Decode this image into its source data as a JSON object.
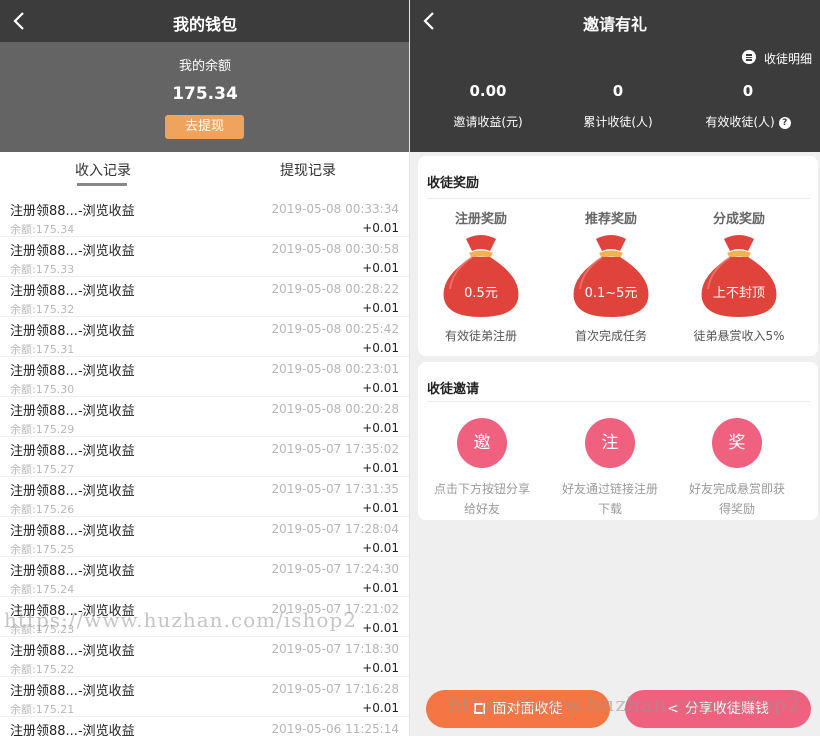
{
  "wallet": {
    "title": "我的钱包",
    "balance_label": "我的余额",
    "balance_value": "175.34",
    "withdraw_button": "去提现",
    "tabs": [
      "收入记录",
      "提现记录"
    ],
    "records": [
      {
        "desc": "注册领88...-浏览收益",
        "date": "2019-05-08 00:33:34",
        "balance": "余额:175.34",
        "amount": "+0.01"
      },
      {
        "desc": "注册领88...-浏览收益",
        "date": "2019-05-08 00:30:58",
        "balance": "余额:175.33",
        "amount": "+0.01"
      },
      {
        "desc": "注册领88...-浏览收益",
        "date": "2019-05-08 00:28:22",
        "balance": "余额:175.32",
        "amount": "+0.01"
      },
      {
        "desc": "注册领88...-浏览收益",
        "date": "2019-05-08 00:25:42",
        "balance": "余额:175.31",
        "amount": "+0.01"
      },
      {
        "desc": "注册领88...-浏览收益",
        "date": "2019-05-08 00:23:01",
        "balance": "余额:175.30",
        "amount": "+0.01"
      },
      {
        "desc": "注册领88...-浏览收益",
        "date": "2019-05-08 00:20:28",
        "balance": "余额:175.29",
        "amount": "+0.01"
      },
      {
        "desc": "注册领88...-浏览收益",
        "date": "2019-05-07 17:35:02",
        "balance": "余额:175.27",
        "amount": "+0.01"
      },
      {
        "desc": "注册领88...-浏览收益",
        "date": "2019-05-07 17:31:35",
        "balance": "余额:175.26",
        "amount": "+0.01"
      },
      {
        "desc": "注册领88...-浏览收益",
        "date": "2019-05-07 17:28:04",
        "balance": "余额:175.25",
        "amount": "+0.01"
      },
      {
        "desc": "注册领88...-浏览收益",
        "date": "2019-05-07 17:24:30",
        "balance": "余额:175.24",
        "amount": "+0.01"
      },
      {
        "desc": "注册领88...-浏览收益",
        "date": "2019-05-07 17:21:02",
        "balance": "余额:175.23",
        "amount": "+0.01"
      },
      {
        "desc": "注册领88...-浏览收益",
        "date": "2019-05-07 17:18:30",
        "balance": "余额:175.22",
        "amount": "+0.01"
      },
      {
        "desc": "注册领88...-浏览收益",
        "date": "2019-05-07 17:16:28",
        "balance": "余额:175.21",
        "amount": "+0.01"
      },
      {
        "desc": "注册领88...-浏览收益",
        "date": "2019-05-06 11:25:14",
        "balance": "",
        "amount": ""
      }
    ]
  },
  "invite": {
    "title": "邀请有礼",
    "detail_link": "收徒明细",
    "stats": [
      {
        "value": "0.00",
        "label": "邀请收益(元)"
      },
      {
        "value": "0",
        "label": "累计收徒(人)"
      },
      {
        "value": "0",
        "label": "有效收徒(人)"
      }
    ],
    "reward_card": {
      "title": "收徒奖励",
      "items": [
        {
          "title": "注册奖励",
          "amount": "0.5元",
          "desc": "有效徒弟注册"
        },
        {
          "title": "推荐奖励",
          "amount": "0.1~5元",
          "desc": "首次完成任务"
        },
        {
          "title": "分成奖励",
          "amount": "上不封顶",
          "desc": "徒弟悬赏收入5%"
        }
      ]
    },
    "invite_card": {
      "title": "收徒邀请",
      "steps": [
        {
          "icon_char": "邀",
          "desc1": "点击下方按钮分享",
          "desc2": "给好友"
        },
        {
          "icon_char": "注",
          "desc1": "好友通过链接注册",
          "desc2": "下载"
        },
        {
          "icon_char": "奖",
          "desc1": "好友完成悬赏即获",
          "desc2": "得奖励"
        }
      ]
    },
    "buttons": {
      "face_to_face": "面对面收徒",
      "share": "分享收徒赚钱"
    }
  },
  "watermark": "https://www.huzhan.com/ishop2",
  "colors": {
    "header": "#3c3c3c",
    "accent_orange": "#f0a35c",
    "pink": "#f0607f",
    "bag_red": "#e0433c"
  }
}
